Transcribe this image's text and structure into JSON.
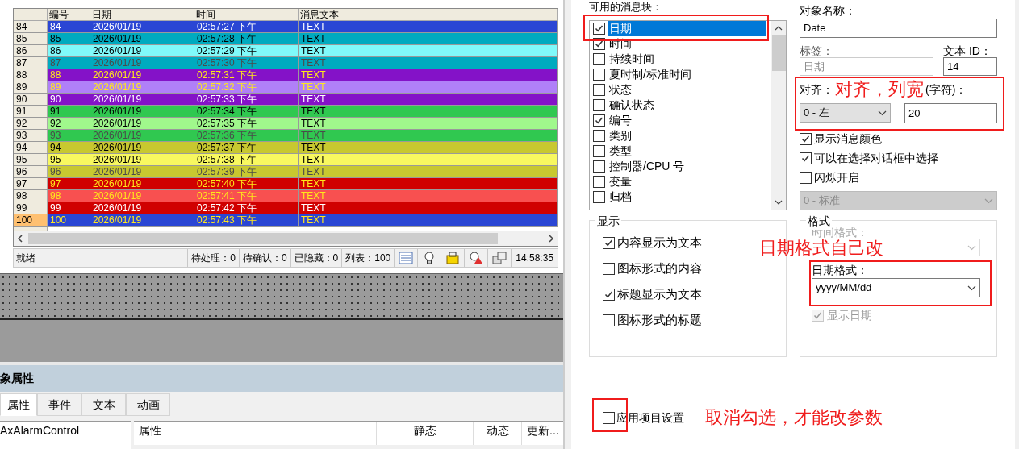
{
  "alarm_table": {
    "columns": [
      "编号",
      "日期",
      "时间",
      "消息文本"
    ],
    "rows": [
      {
        "index": "84",
        "id": "84",
        "date": "2026/01/19",
        "time": "02:57:27 下午",
        "text": "TEXT",
        "color": "#2a46d4",
        "kind": "light",
        "selected": false
      },
      {
        "index": "85",
        "id": "85",
        "date": "2026/01/19",
        "time": "02:57:28 下午",
        "text": "TEXT",
        "color": "#00aabf",
        "kind": "dark",
        "selected": false
      },
      {
        "index": "86",
        "id": "86",
        "date": "2026/01/19",
        "time": "02:57:29 下午",
        "text": "TEXT",
        "color": "#80fafa",
        "kind": "dark",
        "selected": false
      },
      {
        "index": "87",
        "id": "87",
        "date": "2026/01/19",
        "time": "02:57:30 下午",
        "text": "TEXT",
        "color": "#00aabf",
        "kind": "dim",
        "selected": false
      },
      {
        "index": "88",
        "id": "88",
        "date": "2026/01/19",
        "time": "02:57:31 下午",
        "text": "TEXT",
        "color": "#8412c8",
        "kind": "highlight",
        "selected": false
      },
      {
        "index": "89",
        "id": "89",
        "date": "2026/01/19",
        "time": "02:57:32 下午",
        "text": "TEXT",
        "color": "#b080f8",
        "kind": "highlight",
        "selected": false
      },
      {
        "index": "90",
        "id": "90",
        "date": "2026/01/19",
        "time": "02:57:33 下午",
        "text": "TEXT",
        "color": "#8412c8",
        "kind": "light",
        "selected": false
      },
      {
        "index": "91",
        "id": "91",
        "date": "2026/01/19",
        "time": "02:57:34 下午",
        "text": "TEXT",
        "color": "#30c850",
        "kind": "dark",
        "selected": false
      },
      {
        "index": "92",
        "id": "92",
        "date": "2026/01/19",
        "time": "02:57:35 下午",
        "text": "TEXT",
        "color": "#a0f88c",
        "kind": "dark",
        "selected": false
      },
      {
        "index": "93",
        "id": "93",
        "date": "2026/01/19",
        "time": "02:57:36 下午",
        "text": "TEXT",
        "color": "#30c850",
        "kind": "dim",
        "selected": false
      },
      {
        "index": "94",
        "id": "94",
        "date": "2026/01/19",
        "time": "02:57:37 下午",
        "text": "TEXT",
        "color": "#c8c830",
        "kind": "dark",
        "selected": false
      },
      {
        "index": "95",
        "id": "95",
        "date": "2026/01/19",
        "time": "02:57:38 下午",
        "text": "TEXT",
        "color": "#f8f860",
        "kind": "dark",
        "selected": false
      },
      {
        "index": "96",
        "id": "96",
        "date": "2026/01/19",
        "time": "02:57:39 下午",
        "text": "TEXT",
        "color": "#c8c830",
        "kind": "dim",
        "selected": false
      },
      {
        "index": "97",
        "id": "97",
        "date": "2026/01/19",
        "time": "02:57:40 下午",
        "text": "TEXT",
        "color": "#d00000",
        "kind": "highlight",
        "selected": false
      },
      {
        "index": "98",
        "id": "98",
        "date": "2026/01/19",
        "time": "02:57:41 下午",
        "text": "TEXT",
        "color": "#f85050",
        "kind": "highlight",
        "selected": false
      },
      {
        "index": "99",
        "id": "99",
        "date": "2026/01/19",
        "time": "02:57:42 下午",
        "text": "TEXT",
        "color": "#d00000",
        "kind": "light",
        "selected": false
      },
      {
        "index": "100",
        "id": "100",
        "date": "2026/01/19",
        "time": "02:57:43 下午",
        "text": "TEXT",
        "color": "#2a46d4",
        "kind": "highlight",
        "selected": true
      }
    ]
  },
  "status_bar": {
    "status": "就绪",
    "counters": [
      "待处理：0",
      "待确认：0",
      "已隐藏：0",
      "列表：100"
    ],
    "time": "14:58:35"
  },
  "properties_panel": {
    "title": "象属性",
    "tabs": [
      {
        "label": "属性",
        "selected": true
      },
      {
        "label": "事件",
        "selected": false
      },
      {
        "label": "文本",
        "selected": false
      },
      {
        "label": "动画",
        "selected": false
      }
    ],
    "tree_item": "AxAlarmControl",
    "columns": [
      "属性",
      "静态",
      "动态",
      "更新..."
    ]
  },
  "blocks": {
    "label": "可用的消息块：",
    "items": [
      {
        "label": "日期",
        "checked": true,
        "selected": true
      },
      {
        "label": "时间",
        "checked": true,
        "selected": false
      },
      {
        "label": "持续时间",
        "checked": false,
        "selected": false
      },
      {
        "label": "夏时制/标准时间",
        "checked": false,
        "selected": false
      },
      {
        "label": "状态",
        "checked": false,
        "selected": false
      },
      {
        "label": "确认状态",
        "checked": false,
        "selected": false
      },
      {
        "label": "编号",
        "checked": true,
        "selected": false
      },
      {
        "label": "类别",
        "checked": false,
        "selected": false
      },
      {
        "label": "类型",
        "checked": false,
        "selected": false
      },
      {
        "label": "控制器/CPU 号",
        "checked": false,
        "selected": false
      },
      {
        "label": "变量",
        "checked": false,
        "selected": false
      },
      {
        "label": "归档",
        "checked": false,
        "selected": false
      }
    ]
  },
  "object_name": {
    "label": "对象名称：",
    "value": "Date"
  },
  "tag": {
    "label": "标签：",
    "value": "日期",
    "disabled": true
  },
  "text_id": {
    "label": "文本 ID：",
    "value": "14"
  },
  "alignment": {
    "label": "对齐：",
    "value": "0 - 左"
  },
  "width": {
    "label": "(字符)：",
    "value": "20"
  },
  "options": [
    {
      "label": "显示消息颜色",
      "checked": true
    },
    {
      "label": "可以在选择对话框中选择",
      "checked": true
    },
    {
      "label": "闪烁开启",
      "checked": false
    }
  ],
  "flash_mode": {
    "value": "0 - 标准",
    "disabled": true
  },
  "display_group": {
    "title": "显示",
    "items": [
      {
        "label": "内容显示为文本",
        "checked": true
      },
      {
        "label": "图标形式的内容",
        "checked": false
      },
      {
        "label": "标题显示为文本",
        "checked": true
      },
      {
        "label": "图标形式的标题",
        "checked": false
      }
    ]
  },
  "format_group": {
    "title": "格式",
    "time_format_label": "时间格式：",
    "date_format_label": "日期格式：",
    "date_format": "yyyy/MM/dd",
    "show_date": {
      "label": "显示日期",
      "checked": true,
      "disabled": true
    }
  },
  "apply_project_settings": {
    "label": "应用项目设置",
    "checked": false
  },
  "annotations": [
    "对齐，列宽",
    "日期格式自己改",
    "取消勾选，才能改参数"
  ]
}
